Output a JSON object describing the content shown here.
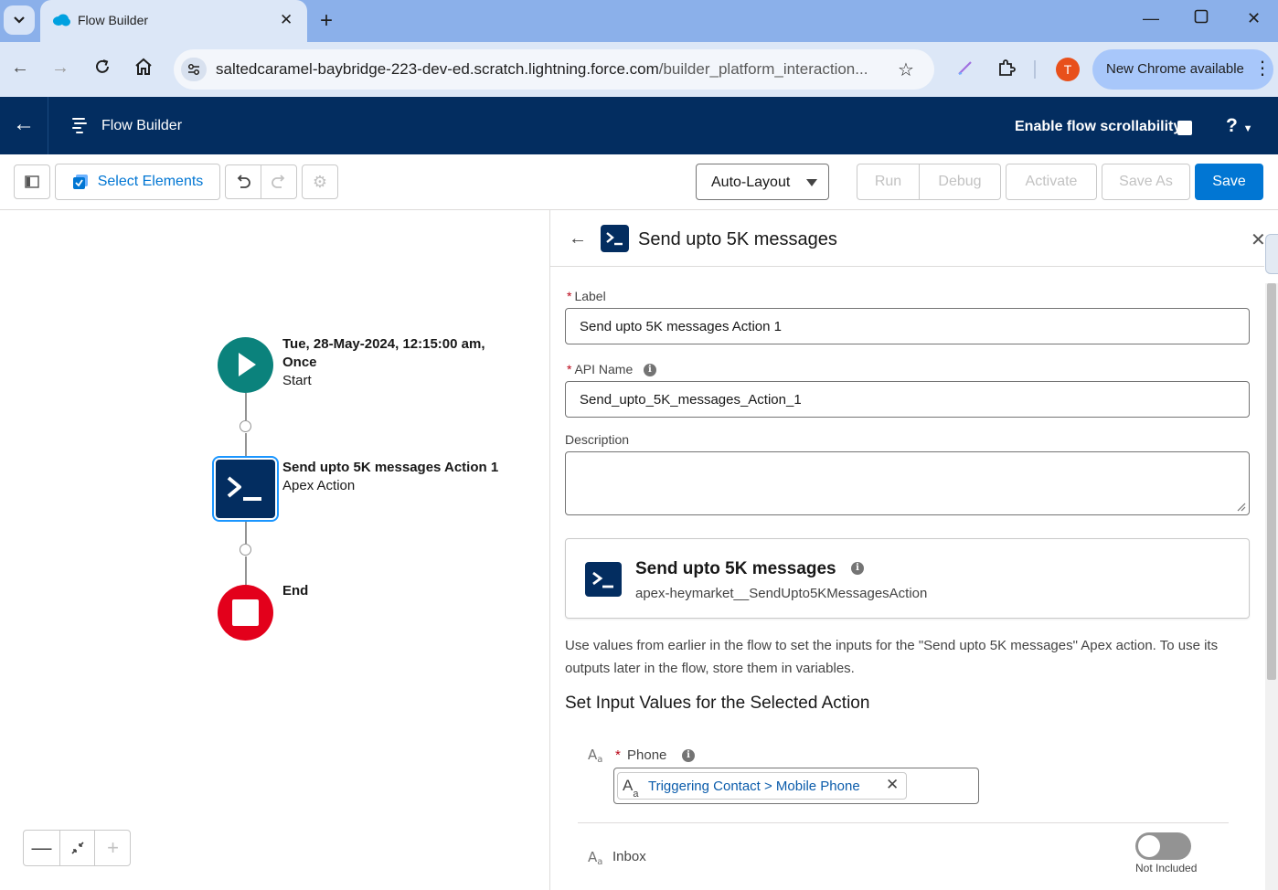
{
  "browser": {
    "tab_title": "Flow Builder",
    "url_host": "saltedcaramel-baybridge-223-dev-ed.scratch.lightning.force.com",
    "url_path": "/builder_platform_interaction...",
    "avatar_letter": "T",
    "update_label": "New Chrome available"
  },
  "header": {
    "title": "Flow Builder",
    "scroll_label": "Enable flow scrollability",
    "help": "?"
  },
  "toolbar": {
    "select_elements": "Select Elements",
    "layout": "Auto-Layout",
    "run": "Run",
    "debug": "Debug",
    "activate": "Activate",
    "save_as": "Save As",
    "save": "Save"
  },
  "canvas": {
    "start_title_line1": "Tue, 28-May-2024, 12:15:00 am,",
    "start_title_line2": "Once",
    "start_subtitle": "Start",
    "action_title": "Send upto 5K messages Action 1",
    "action_subtitle": "Apex Action",
    "end_title": "End"
  },
  "panel": {
    "title": "Send upto 5K messages",
    "label_field": {
      "label": "Label",
      "value": "Send upto 5K messages Action 1"
    },
    "api_field": {
      "label": "API Name",
      "value": "Send_upto_5K_messages_Action_1"
    },
    "description_field": {
      "label": "Description",
      "value": ""
    },
    "action_card": {
      "name": "Send upto 5K messages",
      "api_name": "apex-heymarket__SendUpto5KMessagesAction"
    },
    "help_text": "Use values from earlier in the flow to set the inputs for the \"Send upto 5K messages\" Apex action. To use its outputs later in the flow, store them in variables.",
    "section_title": "Set Input Values for the Selected Action",
    "inputs": {
      "phone_label": "Phone",
      "phone_value": "Triggering Contact > Mobile Phone",
      "inbox_label": "Inbox",
      "inbox_toggle_label": "Not Included"
    }
  },
  "colors": {
    "header_bg": "#032d60",
    "brand_blue": "#0176d3",
    "start_green": "#0b827c",
    "end_red": "#e3001b"
  }
}
